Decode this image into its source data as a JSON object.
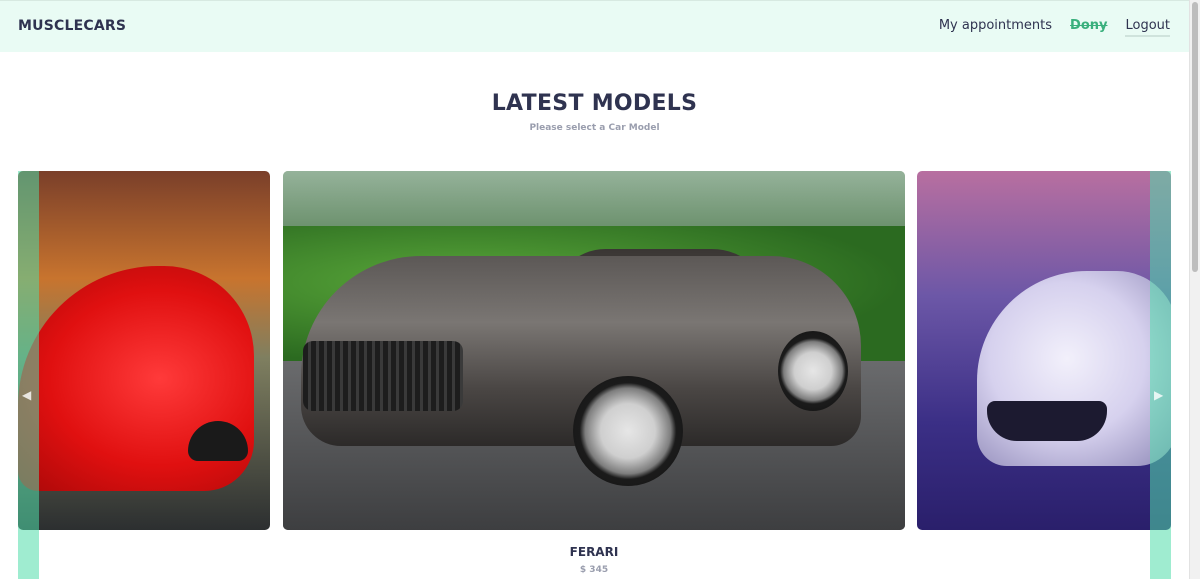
{
  "navbar": {
    "brand": "MUSCLECARS",
    "links": {
      "appointments": "My appointments",
      "user": "Dony",
      "logout": "Logout"
    }
  },
  "main": {
    "title": "LATEST MODELS",
    "subtitle": "Please select a Car Model"
  },
  "carousel": {
    "prev_icon": "chevron-left-icon",
    "next_icon": "chevron-right-icon",
    "active_item": {
      "name": "FERARI",
      "price": "$ 345"
    }
  },
  "colors": {
    "navbar_bg": "#e9fbf4",
    "accent": "#3ab07d",
    "text": "#2f3350",
    "muted": "#9a9eae"
  }
}
